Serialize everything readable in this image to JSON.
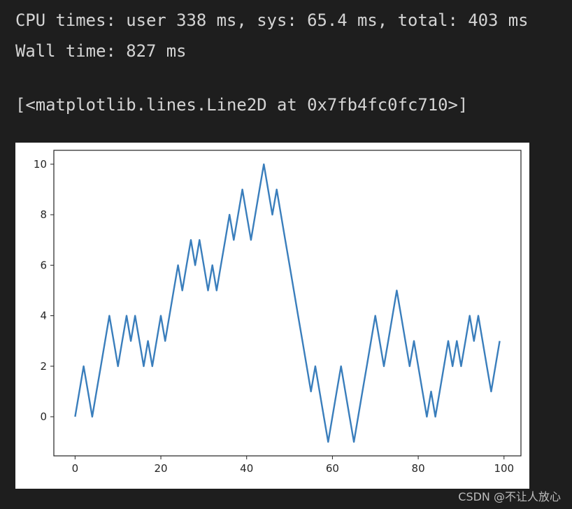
{
  "output": {
    "cpu_times": "CPU times: user 338 ms, sys: 65.4 ms, total: 403 ms",
    "wall_time": "Wall time: 827 ms",
    "repr": "[<matplotlib.lines.Line2D at 0x7fb4fc0fc710>]"
  },
  "watermark": "CSDN @不让人放心",
  "chart_data": {
    "type": "line",
    "title": "",
    "xlabel": "",
    "ylabel": "",
    "xlim": [
      -4.95,
      103.95
    ],
    "ylim": [
      -1.55,
      10.55
    ],
    "xticks": [
      0,
      20,
      40,
      60,
      80,
      100
    ],
    "yticks": [
      0,
      2,
      4,
      6,
      8,
      10
    ],
    "grid": false,
    "line_color": "#3a7ebc",
    "x_start": 0,
    "values": [
      0,
      1,
      2,
      1,
      0,
      1,
      2,
      3,
      4,
      3,
      2,
      3,
      4,
      3,
      4,
      3,
      2,
      3,
      2,
      3,
      4,
      3,
      4,
      5,
      6,
      5,
      6,
      7,
      6,
      7,
      6,
      5,
      6,
      5,
      6,
      7,
      8,
      7,
      8,
      9,
      8,
      7,
      8,
      9,
      10,
      9,
      8,
      9,
      8,
      7,
      6,
      5,
      4,
      3,
      2,
      1,
      2,
      1,
      0,
      -1,
      0,
      1,
      2,
      1,
      0,
      -1,
      0,
      1,
      2,
      3,
      4,
      3,
      2,
      3,
      4,
      5,
      4,
      3,
      2,
      3,
      2,
      1,
      0,
      1,
      0,
      1,
      2,
      3,
      2,
      3,
      2,
      3,
      4,
      3,
      4,
      3,
      2,
      1,
      2,
      3
    ]
  }
}
